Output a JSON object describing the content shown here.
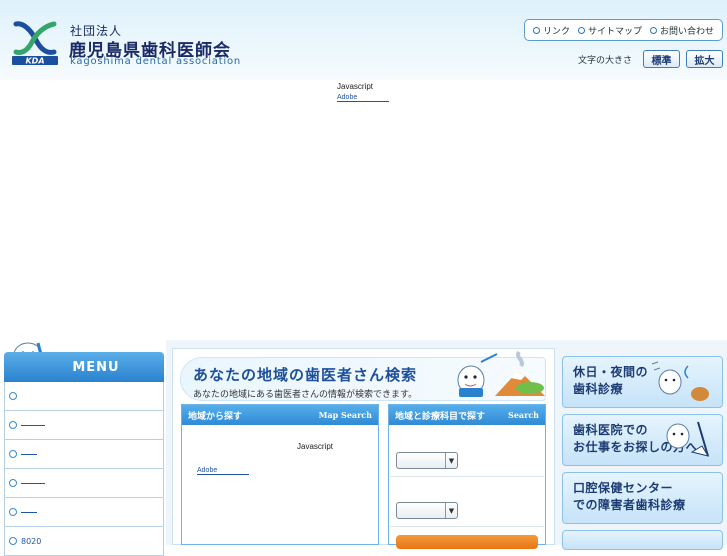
{
  "header": {
    "org_prefix": "社団法人",
    "org_name": "鹿児島県歯科医師会",
    "org_name_en": "kagoshima dental association",
    "logo_letters": "KDA",
    "nav": [
      {
        "label": "リンク"
      },
      {
        "label": "サイトマップ"
      },
      {
        "label": "お問い合わせ"
      }
    ],
    "font_size_label": "文字の大きさ",
    "font_size_standard": "標準",
    "font_size_large": "拡大"
  },
  "notice": {
    "text": "Javascript",
    "link": "Adobe"
  },
  "sidebar": {
    "menu_title": "MENU",
    "items": [
      {
        "label": ""
      },
      {
        "label": ""
      },
      {
        "label": ""
      },
      {
        "label": ""
      },
      {
        "label": ""
      },
      {
        "label": "8020"
      }
    ]
  },
  "search": {
    "title": "あなたの地域の歯医者さん検索",
    "subtitle": "あなたの地域にある歯医者さんの情報が検索できます。",
    "panel_area": {
      "label": "地域から探す",
      "label_en": "Map Search",
      "notice": "Javascript",
      "link": "Adobe"
    },
    "panel_dept": {
      "label": "地域と診療科目で探す",
      "label_en": "Search"
    }
  },
  "right_banners": [
    {
      "label": "休日・夜間の\n歯科診療"
    },
    {
      "label": "歯科医院での\nお仕事をお探しの方へ"
    },
    {
      "label": "口腔保健センター\nでの障害者歯科診療"
    }
  ],
  "colors": {
    "brand_blue": "#2a82cf",
    "navy": "#1d3c74",
    "accent_orange": "#e77616"
  }
}
